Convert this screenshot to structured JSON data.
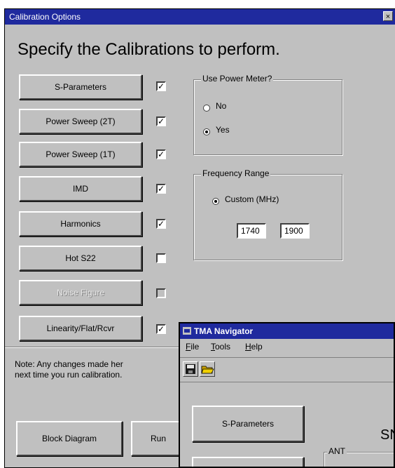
{
  "dialog": {
    "title": "Calibration Options",
    "close_glyph": "×",
    "heading": "Specify the Calibrations to perform.",
    "calibrations": [
      {
        "label": "S-Parameters",
        "checked": true,
        "enabled": true
      },
      {
        "label": "Power Sweep (2T)",
        "checked": true,
        "enabled": true
      },
      {
        "label": "Power Sweep (1T)",
        "checked": true,
        "enabled": true
      },
      {
        "label": "IMD",
        "checked": true,
        "enabled": true
      },
      {
        "label": "Harmonics",
        "checked": true,
        "enabled": true
      },
      {
        "label": "Hot S22",
        "checked": false,
        "enabled": true
      },
      {
        "label": "Noise Figure",
        "checked": false,
        "enabled": false
      },
      {
        "label": "Linearity/Flat/Rcvr",
        "checked": true,
        "enabled": true
      }
    ],
    "check_glyph": "✓",
    "power_meter": {
      "legend": "Use Power Meter?",
      "options": [
        {
          "label": "No",
          "selected": false
        },
        {
          "label": "Yes",
          "selected": true
        }
      ]
    },
    "frequency_range": {
      "legend": "Frequency Range",
      "option_label": "Custom (MHz)",
      "start": "1740",
      "stop": "1900"
    },
    "note_line1": "Note: Any changes made her",
    "note_line2": "next time you run calibration.",
    "block_diagram_label": "Block Diagram",
    "run_label": "Run"
  },
  "navigator": {
    "title": "TMA Navigator",
    "menu": [
      {
        "underline": "F",
        "rest": "ile"
      },
      {
        "underline": "T",
        "rest": "ools"
      },
      {
        "underline": "H",
        "rest": "elp"
      }
    ],
    "s_params_label": "S-Parameters",
    "heading_partial": "SN",
    "ant_label": "ANT"
  },
  "colors": {
    "titlebar": "#1f2a9e",
    "face": "#c0c0c0"
  }
}
